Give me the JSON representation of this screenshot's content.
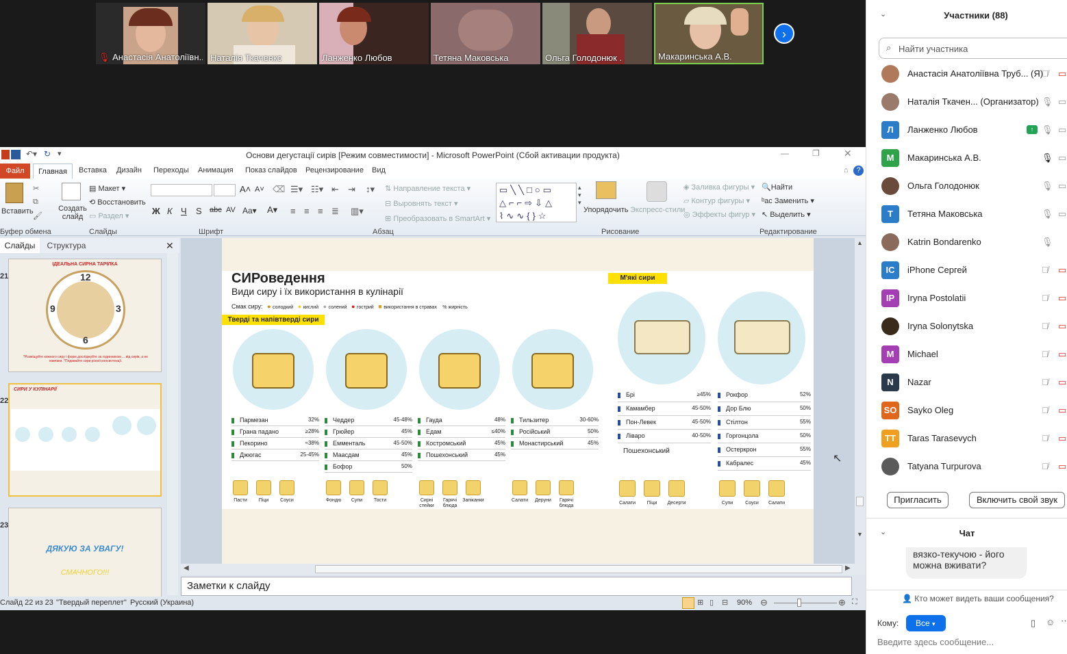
{
  "video_strip": {
    "participants": [
      {
        "name": "Анастасія Анатоліївн...",
        "muted": true
      },
      {
        "name": "Наталія Ткаченко",
        "muted": false
      },
      {
        "name": "Ланженко Любов",
        "muted": false
      },
      {
        "name": "Тетяна Маковська",
        "muted": false
      },
      {
        "name": "Ольга Голодонюк .",
        "muted": false
      },
      {
        "name": "Макаринська А.В.",
        "muted": false
      }
    ],
    "next_icon": "chevron-right-icon"
  },
  "ppt": {
    "title": "Основи дегустації сирів [Режим совместимости]  -  Microsoft PowerPoint (Сбой активации продукта)",
    "tabs": [
      "Файл",
      "Главная",
      "Вставка",
      "Дизайн",
      "Переходы",
      "Анимация",
      "Показ слайдов",
      "Рецензирование",
      "Вид"
    ],
    "ribbon": {
      "paste": "Вставить",
      "clipboard": "Буфер обмена",
      "create_slide": "Создать слайд",
      "layout": "Макет",
      "reset": "Восстановить",
      "section": "Раздел",
      "slides_group": "Слайды",
      "font_group": "Шрифт",
      "text_direction": "Направление текста",
      "align_text": "Выровнять текст",
      "smartart": "Преобразовать в SmartArt",
      "paragraph_group": "Абзац",
      "arrange": "Упорядочить",
      "quick_styles": "Экспресс-стили",
      "shape_fill": "Заливка фигуры",
      "shape_outline": "Контур фигуры",
      "shape_effects": "Эффекты фигур",
      "drawing_group": "Рисование",
      "find": "Найти",
      "replace": "Заменить",
      "select": "Выделить",
      "editing_group": "Редактирование"
    },
    "panes": {
      "slides_tab": "Слайды",
      "outline_tab": "Структура"
    },
    "thumbs": [
      {
        "num": "21",
        "title": "ІДЕАЛЬНА СИРНА ТАРІЛКА",
        "caption": "*Розміщуйте кожного сиру і форм досліджуйте за годинником ... від сирів, а не навпаки. *Подавайте сири різної консистенції."
      },
      {
        "num": "22",
        "title": "СИРИ У КУЛІНАРІЇ"
      },
      {
        "num": "23",
        "line1": "ДЯКУЮ ЗА УВАГУ!",
        "line2": "СМАЧНОГО!!!"
      }
    ],
    "notes": "Заметки к слайду",
    "status": {
      "slide": "Слайд 22 из 23",
      "theme": "\"Твердый переплет\"",
      "lang": "Русский (Украина)",
      "zoom": "90%"
    }
  },
  "slide": {
    "title": "СИРоведення",
    "subtitle": "Види сиру і їх використання в кулінарії",
    "legend": {
      "label": "Смак сиру:",
      "items": [
        "солодкий",
        "кислий",
        "солений",
        "гострий",
        "використання в стравах",
        "% жирність"
      ]
    },
    "hard_badge": "Тверді та напівтверді сири",
    "soft_badge": "М'які сири",
    "hard_cols": [
      {
        "rows": [
          [
            "Пармезан",
            "32%"
          ],
          [
            "Грана падано",
            "≥28%"
          ],
          [
            "Пекорино",
            "≈38%"
          ],
          [
            "Джюгас",
            "25-45%"
          ]
        ],
        "uses": [
          "Пасти",
          "Піци",
          "Соуси"
        ]
      },
      {
        "rows": [
          [
            "Чеддер",
            "45-48%"
          ],
          [
            "Грюйер",
            "45%"
          ],
          [
            "Емменталь",
            "45-50%"
          ],
          [
            "Маасдам",
            "45%"
          ],
          [
            "Бофор",
            "50%"
          ]
        ],
        "uses": [
          "Фондю",
          "Супи",
          "Тости"
        ]
      },
      {
        "rows": [
          [
            "Гауда",
            "48%"
          ],
          [
            "Едам",
            "≤40%"
          ],
          [
            "Костромський",
            "45%"
          ],
          [
            "Пошехонський",
            "45%"
          ]
        ],
        "uses": [
          "Сирні стейки",
          "Гарячі блюда",
          "Запіканки"
        ]
      },
      {
        "rows": [
          [
            "Тильзитер",
            "30-60%"
          ],
          [
            "Російський",
            "50%"
          ],
          [
            "Монастирський",
            "45%"
          ]
        ],
        "uses": [
          "Салати",
          "Деруни",
          "Гарячі блюда"
        ]
      }
    ],
    "soft_cols": [
      {
        "rows": [
          [
            "Брі",
            "≥45%"
          ],
          [
            "Камамбер",
            "45-50%"
          ],
          [
            "Пон-Левек",
            "45-50%"
          ],
          [
            "Ліваро",
            "40-50%"
          ]
        ],
        "extra": "Пошехонський",
        "uses": [
          "Салати",
          "Піци",
          "Десерти"
        ]
      },
      {
        "rows": [
          [
            "Рокфор",
            "52%"
          ],
          [
            "Дор Блю",
            "50%"
          ],
          [
            "Стілтон",
            "55%"
          ],
          [
            "Горгонцола",
            "50%"
          ],
          [
            "Остеркрон",
            "55%"
          ],
          [
            "Кабралес",
            "45%"
          ]
        ],
        "uses": [
          "Супи",
          "Соуси",
          "Салати"
        ]
      }
    ]
  },
  "right": {
    "participants_title": "Участники (88)",
    "search_placeholder": "Найти участника",
    "list": [
      {
        "initial": "",
        "name": "Анастасія Анатоліївна Труб... (Я)",
        "color": "#b07a5a",
        "mic": "muted",
        "cam": "off"
      },
      {
        "initial": "",
        "name": "Наталія Ткачен...  (Организатор)",
        "color": "#9a7a6a",
        "mic": "on",
        "cam": "on"
      },
      {
        "initial": "Л",
        "name": "Ланженко Любов",
        "color": "#2b7cc9",
        "mic": "on",
        "cam": "on",
        "share": true
      },
      {
        "initial": "М",
        "name": "Макаринська А.В.",
        "color": "#2ea34a",
        "mic": "active",
        "cam": "on"
      },
      {
        "initial": "",
        "name": "Ольга Голодонюк",
        "color": "#6a4a3a",
        "mic": "on",
        "cam": "on"
      },
      {
        "initial": "Т",
        "name": "Тетяна Маковська",
        "color": "#2b7cc9",
        "mic": "on",
        "cam": "on"
      },
      {
        "initial": "",
        "name": "Katrin Bondarenko",
        "color": "#8a6a5a",
        "mic": "on",
        "cam": "none"
      },
      {
        "initial": "IC",
        "name": "iPhone Сергей",
        "color": "#2b7cc9",
        "mic": "muted",
        "cam": "off"
      },
      {
        "initial": "IP",
        "name": "Iryna Postolatii",
        "color": "#a33fb3",
        "mic": "muted",
        "cam": "off"
      },
      {
        "initial": "",
        "name": "Iryna Solonytska",
        "color": "#3a2a1a",
        "mic": "muted",
        "cam": "off"
      },
      {
        "initial": "M",
        "name": "Michael",
        "color": "#a33fb3",
        "mic": "muted",
        "cam": "off"
      },
      {
        "initial": "N",
        "name": "Nazar",
        "color": "#2a3a4a",
        "mic": "muted",
        "cam": "off"
      },
      {
        "initial": "SO",
        "name": "Sayko Oleg",
        "color": "#e0661a",
        "mic": "muted",
        "cam": "off"
      },
      {
        "initial": "TT",
        "name": "Taras Tarasevych",
        "color": "#f0a020",
        "mic": "muted",
        "cam": "off"
      },
      {
        "initial": "",
        "name": "Tatyana Turpurova",
        "color": "#5a5a5a",
        "mic": "muted",
        "cam": "off"
      }
    ],
    "invite": "Пригласить",
    "unmute": "Включить свой звук",
    "chat_title": "Чат",
    "chat_message": "вязко-текучою - його можна вживати?",
    "who_can_see": "Кто может видеть ваши сообщения?",
    "to_label": "Кому:",
    "to_value": "Все",
    "input_placeholder": "Введите здесь сообщение..."
  }
}
